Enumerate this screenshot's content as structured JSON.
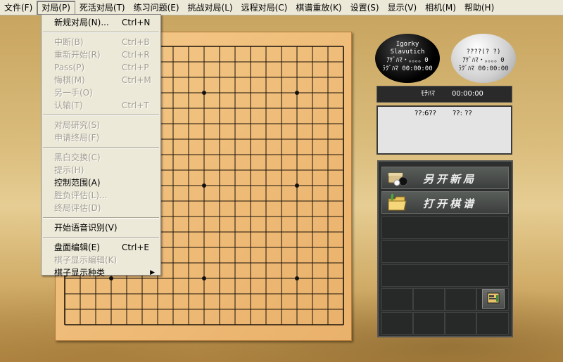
{
  "menubar": [
    "文件(F)",
    "对局(P)",
    "死活对局(T)",
    "练习问题(E)",
    "挑战对局(L)",
    "远程对局(C)",
    "棋谱重放(K)",
    "设置(S)",
    "显示(V)",
    "相机(M)",
    "帮助(H)"
  ],
  "menu": {
    "items": [
      {
        "label": "新规对局(N)...",
        "shortcut": "Ctrl+N",
        "enabled": true
      },
      {
        "sep": true
      },
      {
        "label": "中断(B)",
        "shortcut": "Ctrl+B",
        "enabled": false
      },
      {
        "label": "重新开始(R)",
        "shortcut": "Ctrl+R",
        "enabled": false
      },
      {
        "label": "Pass(P)",
        "shortcut": "Ctrl+P",
        "enabled": false
      },
      {
        "label": "悔棋(M)",
        "shortcut": "Ctrl+M",
        "enabled": false
      },
      {
        "label": "另一手(O)",
        "shortcut": "",
        "enabled": false
      },
      {
        "label": "认输(T)",
        "shortcut": "Ctrl+T",
        "enabled": false
      },
      {
        "sep": true
      },
      {
        "label": "对局研究(S)",
        "shortcut": "",
        "enabled": false
      },
      {
        "label": "申请终局(F)",
        "shortcut": "",
        "enabled": false
      },
      {
        "sep": true
      },
      {
        "label": "黑白交换(C)",
        "shortcut": "",
        "enabled": false
      },
      {
        "label": "提示(H)",
        "shortcut": "",
        "enabled": false
      },
      {
        "label": "控制范围(A)",
        "shortcut": "",
        "enabled": true
      },
      {
        "label": "胜负评估(L)...",
        "shortcut": "",
        "enabled": false
      },
      {
        "label": "终局评估(D)",
        "shortcut": "",
        "enabled": false
      },
      {
        "sep": true
      },
      {
        "label": "开始语音识别(V)",
        "shortcut": "",
        "enabled": true
      },
      {
        "sep": true
      },
      {
        "label": "盘面编辑(E)",
        "shortcut": "Ctrl+E",
        "enabled": true
      },
      {
        "label": "棋子显示编辑(K)",
        "shortcut": "",
        "enabled": false
      },
      {
        "label": "棋子显示种类",
        "shortcut": "",
        "enabled": true,
        "submenu": true
      }
    ]
  },
  "board": {
    "size": 19
  },
  "players": {
    "black": {
      "lines": [
        "Igorky",
        "Slavutich",
        "ｱｹﾞﾊﾏ・。。。。0",
        "ﾗｸﾞﾊﾏ 00:00:00"
      ]
    },
    "white": {
      "lines": [
        "????(? ?)",
        "ｱｹﾞﾊﾏ・。。。。0",
        "ﾗｸﾞﾊﾏ 00:00:00"
      ]
    }
  },
  "timer": {
    "label": "ﾓﾁﾊﾏ",
    "value": "00:00:00"
  },
  "info": {
    "left": "??:6??",
    "right": "??: ??"
  },
  "panel": {
    "new_game": "另开新局",
    "open_record": "打开棋谱"
  },
  "colors": {
    "menu_bg": "#ece9d8",
    "disabled": "#a39e92",
    "board": "#f0bf7c",
    "panel": "#2c2f2d"
  }
}
